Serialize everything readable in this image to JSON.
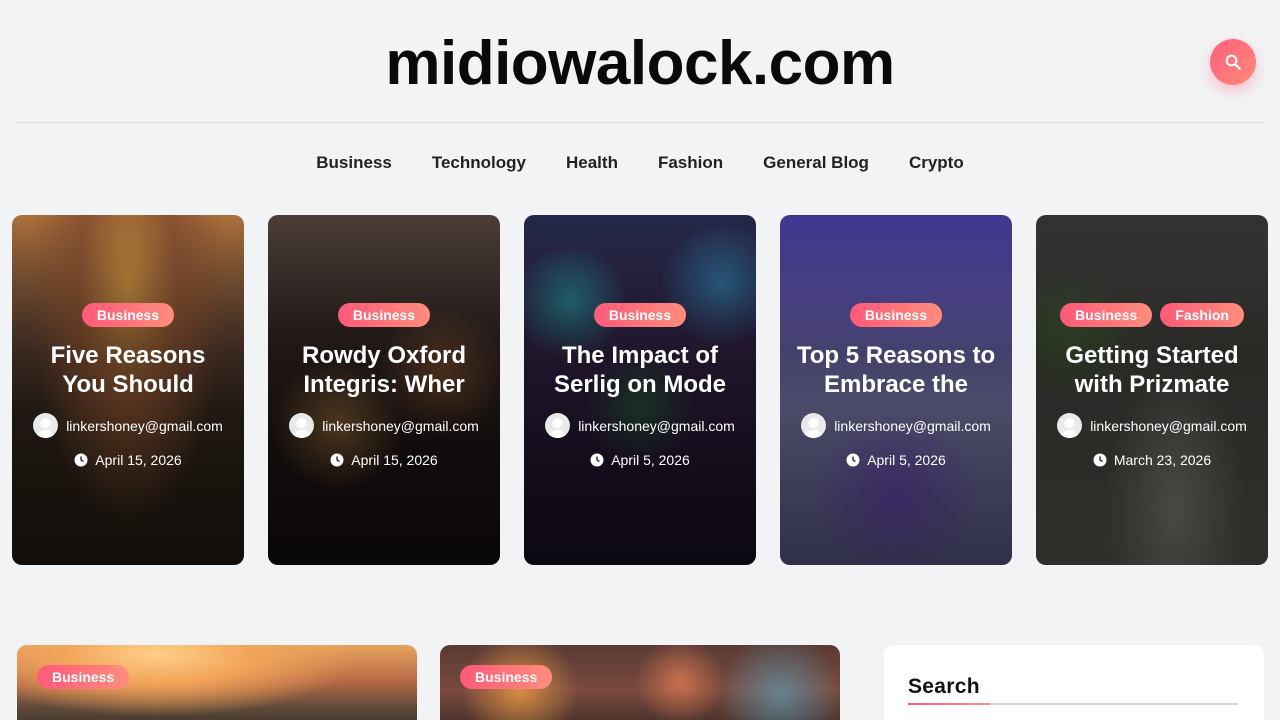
{
  "site": {
    "title": "midiowalock.com"
  },
  "nav": {
    "items": [
      "Business",
      "Technology",
      "Health",
      "Fashion",
      "General Blog",
      "Crypto"
    ]
  },
  "featured": [
    {
      "categories": [
        "Business"
      ],
      "title": "Five Reasons You Should",
      "author": "linkershoney@gmail.com",
      "date": "April 15, 2026"
    },
    {
      "categories": [
        "Business"
      ],
      "title": "Rowdy Oxford Integris: Wher",
      "author": "linkershoney@gmail.com",
      "date": "April 15, 2026"
    },
    {
      "categories": [
        "Business"
      ],
      "title": "The Impact of Serlig on Mode",
      "author": "linkershoney@gmail.com",
      "date": "April 5, 2026"
    },
    {
      "categories": [
        "Business"
      ],
      "title": "Top 5 Reasons to Embrace the",
      "author": "linkershoney@gmail.com",
      "date": "April 5, 2026"
    },
    {
      "categories": [
        "Business",
        "Fashion"
      ],
      "title": "Getting Started with Prizmate",
      "author": "linkershoney@gmail.com",
      "date": "March 23, 2026"
    }
  ],
  "posts": [
    {
      "category": "Business"
    },
    {
      "category": "Business"
    }
  ],
  "sidebar": {
    "search_title": "Search"
  },
  "colors": {
    "accent": "#ff5f7e",
    "accent_end": "#ff8a78",
    "background": "#f2f3f5"
  },
  "icons": {
    "search": "search-icon",
    "author": "user-avatar-icon",
    "date": "clock-icon"
  }
}
